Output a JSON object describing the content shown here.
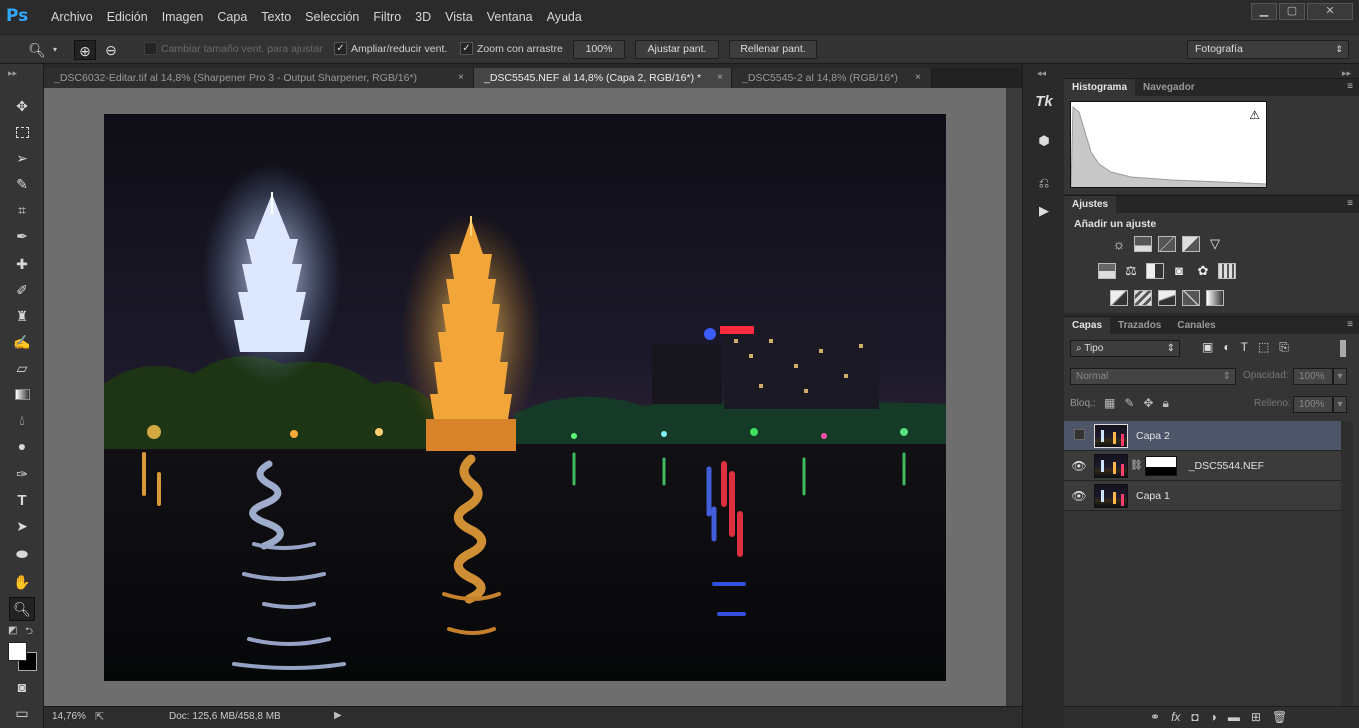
{
  "app": {
    "logo": "Ps"
  },
  "menu": [
    "Archivo",
    "Edición",
    "Imagen",
    "Capa",
    "Texto",
    "Selección",
    "Filtro",
    "3D",
    "Vista",
    "Ventana",
    "Ayuda"
  ],
  "window_controls": {
    "minimize": "▁",
    "maximize": "▢",
    "close": "✕"
  },
  "options": {
    "resize_windows": "Cambiar tamaño vent. para ajustar",
    "zoom_all": "Ampliar/reducir vent.",
    "scrubby_zoom": "Zoom con arrastre",
    "actual_pixels": "100%",
    "fit_screen": "Ajustar pant.",
    "fill_screen": "Rellenar pant.",
    "workspace": "Fotografía"
  },
  "tabs": [
    {
      "label": "_DSC6032-Editar.tif al 14,8% (Sharpener Pro 3 - Output Sharpener, RGB/16*)",
      "close": "×"
    },
    {
      "label": "_DSC5545.NEF al 14,8% (Capa 2, RGB/16*) *",
      "close": "×"
    },
    {
      "label": "_DSC5545-2 al 14,8% (RGB/16*)",
      "close": "×"
    }
  ],
  "status": {
    "zoom": "14,76%",
    "doc": "Doc: 125,6 MB/458,8 MB"
  },
  "panels": {
    "histogram": {
      "tab1": "Histograma",
      "tab2": "Navegador",
      "warning": "⚠"
    },
    "adjustments": {
      "tab": "Ajustes",
      "title": "Añadir un ajuste"
    },
    "layers": {
      "tabs": [
        "Capas",
        "Trazados",
        "Canales"
      ],
      "filter_kind": "Tipo",
      "blend_mode": "Normal",
      "opacity_label": "Opacidad:",
      "opacity_value": "100%",
      "lock_label": "Bloq.:",
      "fill_label": "Relleno:",
      "fill_value": "100%",
      "items": [
        {
          "name": "Capa 2",
          "visible": false,
          "selected": true
        },
        {
          "name": "_DSC5544.NEF",
          "visible": true,
          "selected": false,
          "mask": true
        },
        {
          "name": "Capa 1",
          "visible": true,
          "selected": false
        }
      ]
    }
  },
  "colors": {
    "accent": "#31a8ff",
    "layer_selected": "#4d5569"
  }
}
